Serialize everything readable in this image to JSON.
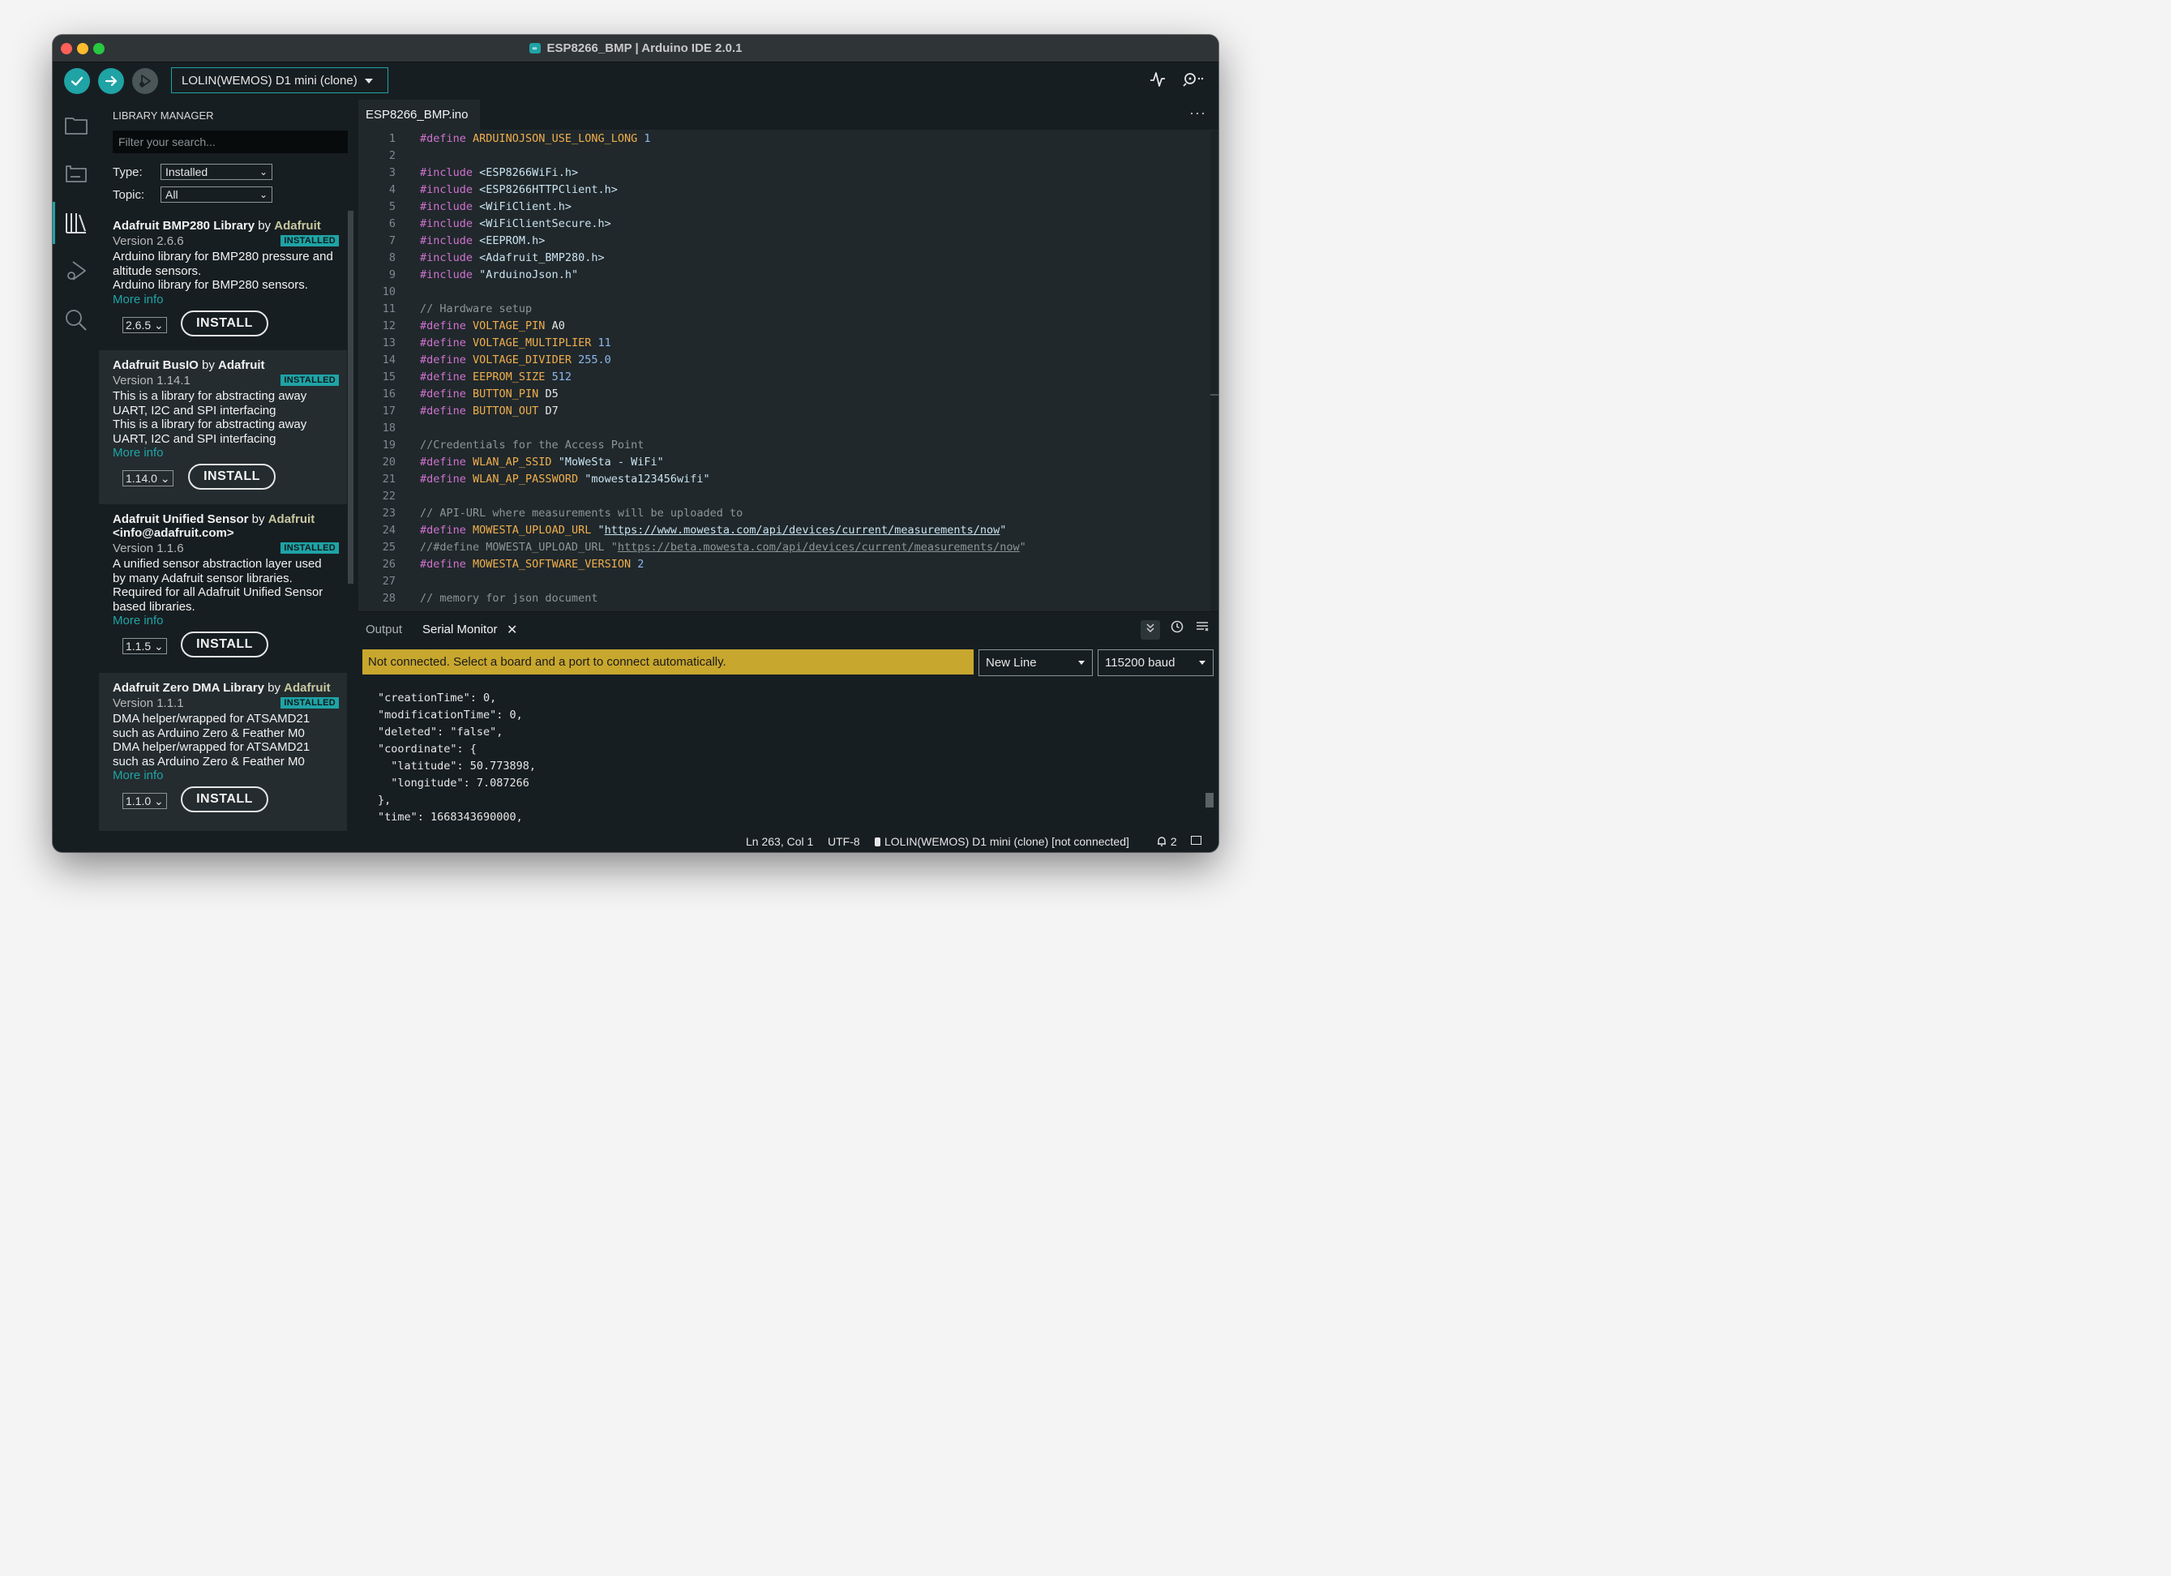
{
  "window": {
    "title": "ESP8266_BMP | Arduino IDE 2.0.1",
    "logo": "∞"
  },
  "toolbar": {
    "verify_icon": "checkmark-icon",
    "upload_icon": "arrow-right-icon",
    "debug_icon": "debug-icon",
    "board": "LOLIN(WEMOS) D1 mini (clone)",
    "plotter_icon": "serial-plotter-icon",
    "serial_monitor_icon": "serial-monitor-icon"
  },
  "sidebar": {
    "icons": [
      "folder-icon",
      "board-manager-icon",
      "library-icon",
      "debug-icon",
      "search-icon"
    ]
  },
  "library_manager": {
    "title": "LIBRARY MANAGER",
    "search_placeholder": "Filter your search...",
    "type_label": "Type:",
    "type_value": "Installed",
    "topic_label": "Topic:",
    "topic_value": "All",
    "items": [
      {
        "name": "Adafruit BMP280 Library",
        "by": " by ",
        "author": "Adafruit",
        "version": "Version 2.6.6",
        "badge": "INSTALLED",
        "description": [
          "Arduino library for BMP280 pressure and",
          "altitude sensors.",
          "Arduino library for BMP280 sensors."
        ],
        "more": "More info",
        "selected_version": "2.6.5",
        "install": "INSTALL"
      },
      {
        "name": "Adafruit BusIO",
        "by": " by ",
        "author": "Adafruit",
        "version": "Version 1.14.1",
        "badge": "INSTALLED",
        "description": [
          "This is a library for abstracting away",
          "UART, I2C and SPI interfacing",
          "This is a library for abstracting away",
          "UART, I2C and SPI interfacing"
        ],
        "more": "More info",
        "selected_version": "1.14.0",
        "install": "INSTALL"
      },
      {
        "name": "Adafruit Unified Sensor",
        "by": " by ",
        "author": "Adafruit",
        "author_line2": "<info@adafruit.com>",
        "version": "Version 1.1.6",
        "badge": "INSTALLED",
        "description": [
          "A unified sensor abstraction layer used",
          "by many Adafruit sensor libraries.",
          "Required for all Adafruit Unified Sensor",
          "based libraries."
        ],
        "more": "More info",
        "selected_version": "1.1.5",
        "install": "INSTALL"
      },
      {
        "name": "Adafruit Zero DMA Library",
        "by": " by ",
        "author": "Adafruit",
        "version": "Version 1.1.1",
        "badge": "INSTALLED",
        "description": [
          "DMA helper/wrapped for ATSAMD21",
          "such as Arduino Zero & Feather M0",
          "DMA helper/wrapped for ATSAMD21",
          "such as Arduino Zero & Feather M0"
        ],
        "more": "More info",
        "selected_version": "1.1.0",
        "install": "INSTALL"
      }
    ]
  },
  "editor": {
    "tab": "ESP8266_BMP.ino",
    "more_icon": "more-icon",
    "lines": [
      [
        [
          "pre",
          "#define "
        ],
        [
          "macro",
          "ARDUINOJSON_USE_LONG_LONG"
        ],
        [
          "num",
          " 1"
        ]
      ],
      [],
      [
        [
          "pre",
          "#include "
        ],
        [
          "str",
          "<ESP8266WiFi.h>"
        ]
      ],
      [
        [
          "pre",
          "#include "
        ],
        [
          "str",
          "<ESP8266HTTPClient.h>"
        ]
      ],
      [
        [
          "pre",
          "#include "
        ],
        [
          "str",
          "<WiFiClient.h>"
        ]
      ],
      [
        [
          "pre",
          "#include "
        ],
        [
          "str",
          "<WiFiClientSecure.h>"
        ]
      ],
      [
        [
          "pre",
          "#include "
        ],
        [
          "str",
          "<EEPROM.h>"
        ]
      ],
      [
        [
          "pre",
          "#include "
        ],
        [
          "str",
          "<Adafruit_BMP280.h>"
        ]
      ],
      [
        [
          "pre",
          "#include "
        ],
        [
          "str",
          "\"ArduinoJson.h\""
        ]
      ],
      [],
      [
        [
          "com",
          "// Hardware setup"
        ]
      ],
      [
        [
          "pre",
          "#define "
        ],
        [
          "macro",
          "VOLTAGE_PIN"
        ],
        [
          "txt",
          " A0"
        ]
      ],
      [
        [
          "pre",
          "#define "
        ],
        [
          "macro",
          "VOLTAGE_MULTIPLIER"
        ],
        [
          "num",
          " 11"
        ]
      ],
      [
        [
          "pre",
          "#define "
        ],
        [
          "macro",
          "VOLTAGE_DIVIDER"
        ],
        [
          "num",
          " 255.0"
        ]
      ],
      [
        [
          "pre",
          "#define "
        ],
        [
          "macro",
          "EEPROM_SIZE"
        ],
        [
          "num",
          " 512"
        ]
      ],
      [
        [
          "pre",
          "#define "
        ],
        [
          "macro",
          "BUTTON_PIN"
        ],
        [
          "txt",
          " D5"
        ]
      ],
      [
        [
          "pre",
          "#define "
        ],
        [
          "macro",
          "BUTTON_OUT"
        ],
        [
          "txt",
          " D7"
        ]
      ],
      [],
      [
        [
          "com",
          "//Credentials for the Access Point"
        ]
      ],
      [
        [
          "pre",
          "#define "
        ],
        [
          "macro",
          "WLAN_AP_SSID"
        ],
        [
          "str",
          " \"MoWeSta - WiFi\""
        ]
      ],
      [
        [
          "pre",
          "#define "
        ],
        [
          "macro",
          "WLAN_AP_PASSWORD"
        ],
        [
          "str",
          " \"mowesta123456wifi\""
        ]
      ],
      [],
      [
        [
          "com",
          "// API-URL where measurements will be uploaded to"
        ]
      ],
      [
        [
          "pre",
          "#define "
        ],
        [
          "macro",
          "MOWESTA_UPLOAD_URL"
        ],
        [
          "str",
          " \""
        ],
        [
          "url",
          "https://www.mowesta.com/api/devices/current/measurements/now"
        ],
        [
          "str",
          "\""
        ]
      ],
      [
        [
          "com",
          "//#define MOWESTA_UPLOAD_URL \""
        ],
        [
          "comurl",
          "https://beta.mowesta.com/api/devices/current/measurements/now"
        ],
        [
          "com",
          "\""
        ]
      ],
      [
        [
          "pre",
          "#define "
        ],
        [
          "macro",
          "MOWESTA_SOFTWARE_VERSION"
        ],
        [
          "num",
          " 2"
        ]
      ],
      [],
      [
        [
          "com",
          "// memory for json document"
        ]
      ]
    ]
  },
  "bottom_panel": {
    "tab_output": "Output",
    "tab_serial": "Serial Monitor",
    "close_icon": "close-icon",
    "autoscroll_icon": "autoscroll-icon",
    "timestamp_icon": "clock-icon",
    "clear_icon": "clear-output-icon",
    "status_message": "Not connected. Select a board and a port to connect automatically.",
    "line_ending": "New Line",
    "baud": "115200 baud",
    "serial_lines": [
      "\"creationTime\": 0,",
      "\"modificationTime\": 0,",
      "\"deleted\": \"false\",",
      "\"coordinate\": {",
      "  \"latitude\": 50.773898,",
      "  \"longitude\": 7.087266",
      "},",
      "\"time\": 1668343690000,"
    ]
  },
  "statusbar": {
    "position": "Ln 263, Col 1",
    "encoding": "UTF-8",
    "board_status": "LOLIN(WEMOS) D1 mini (clone) [not connected]",
    "notifications": "2",
    "bell_icon": "notification-bell-icon",
    "layout_icon": "panel-layout-icon"
  }
}
